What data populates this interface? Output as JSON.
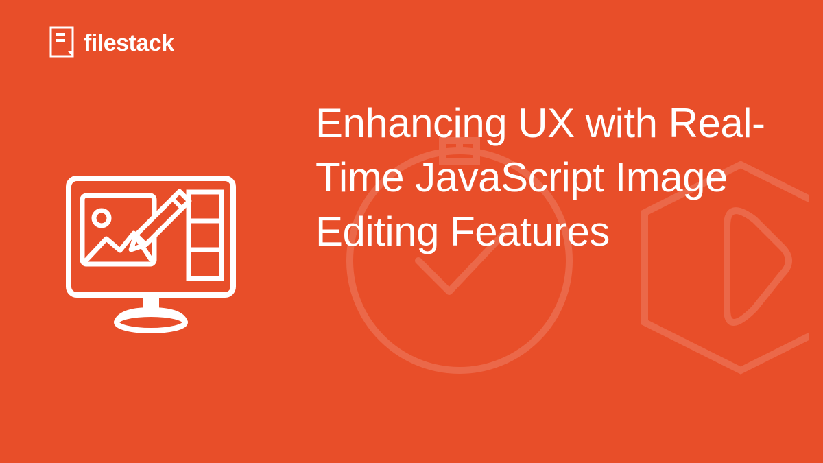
{
  "logo": {
    "brand_name": "filestack"
  },
  "heading": {
    "text": "Enhancing UX with Real-Time JavaScript Image Editing Features"
  },
  "colors": {
    "background": "#E84E29",
    "text": "#FFFFFF"
  }
}
